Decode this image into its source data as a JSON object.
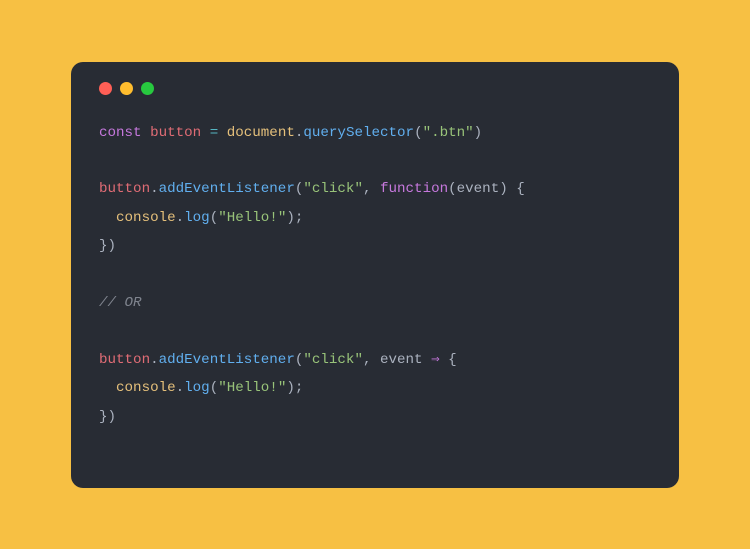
{
  "colors": {
    "bg_page": "#f7c043",
    "bg_window": "#282c34",
    "red": "#ff5f56",
    "yellow": "#ffbd2e",
    "green": "#27c93f",
    "keyword": "#c678dd",
    "var": "#e06c75",
    "operator": "#56b6c2",
    "global": "#e5c07b",
    "prop": "#56b6c2",
    "string": "#98c379",
    "func": "#61afef",
    "plain": "#abb2bf",
    "comment": "#7f848e"
  },
  "code": {
    "l1": {
      "const": "const",
      "sp1": " ",
      "button": "button",
      "sp2": " ",
      "eq": "=",
      "sp3": " ",
      "document": "document",
      "dot": ".",
      "querySelector": "querySelector",
      "open": "(",
      "str": "\".btn\"",
      "close": ")"
    },
    "l2": "",
    "l3": {
      "button": "button",
      "dot": ".",
      "addEventListener": "addEventListener",
      "open": "(",
      "str": "\"click\"",
      "comma": ", ",
      "function": "function",
      "open2": "(",
      "event": "event",
      "close2": ")",
      "sp": " ",
      "brace": "{"
    },
    "l4": {
      "indent": "  ",
      "console": "console",
      "dot": ".",
      "log": "log",
      "open": "(",
      "str": "\"Hello!\"",
      "close": ")",
      "semi": ";"
    },
    "l5": {
      "close": "})"
    },
    "l6": "",
    "l7": {
      "comment": "// OR"
    },
    "l8": "",
    "l9": {
      "button": "button",
      "dot": ".",
      "addEventListener": "addEventListener",
      "open": "(",
      "str": "\"click\"",
      "comma": ", ",
      "event": "event",
      "sp": " ",
      "arrow": "⇒",
      "sp2": " ",
      "brace": "{"
    },
    "l10": {
      "indent": "  ",
      "console": "console",
      "dot": ".",
      "log": "log",
      "open": "(",
      "str": "\"Hello!\"",
      "close": ")",
      "semi": ";"
    },
    "l11": {
      "close": "})"
    }
  }
}
